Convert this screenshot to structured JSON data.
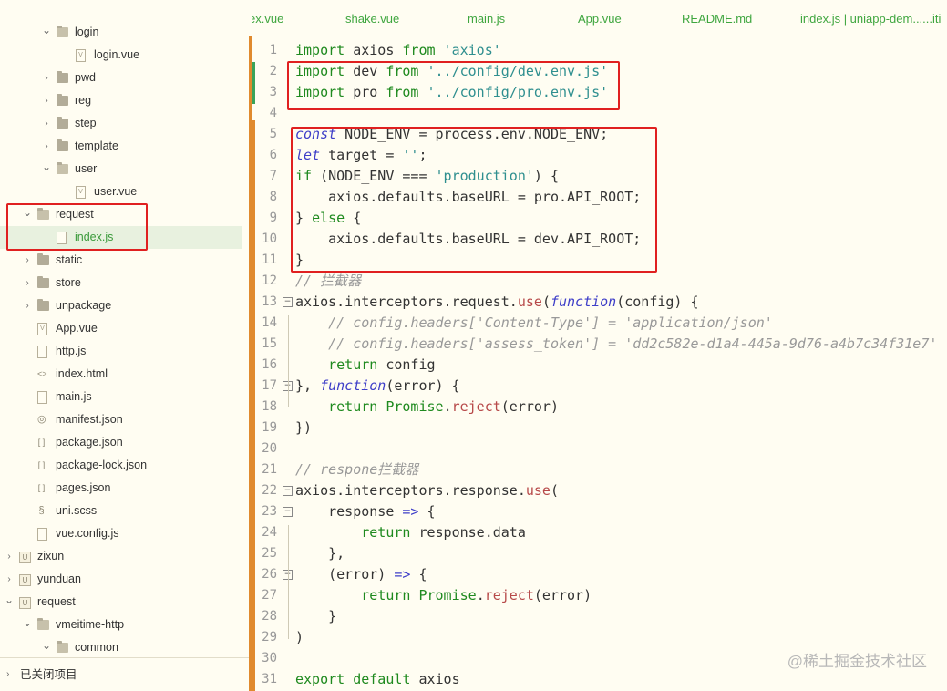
{
  "sidebar": {
    "items": [
      {
        "label": "login",
        "type": "folder",
        "expanded": true,
        "depth": 2
      },
      {
        "label": "login.vue",
        "type": "vue",
        "depth": 3
      },
      {
        "label": "pwd",
        "type": "folder",
        "expanded": false,
        "depth": 2
      },
      {
        "label": "reg",
        "type": "folder",
        "expanded": false,
        "depth": 2
      },
      {
        "label": "step",
        "type": "folder",
        "expanded": false,
        "depth": 2
      },
      {
        "label": "template",
        "type": "folder",
        "expanded": false,
        "depth": 2
      },
      {
        "label": "user",
        "type": "folder",
        "expanded": true,
        "depth": 2
      },
      {
        "label": "user.vue",
        "type": "vue",
        "depth": 3
      },
      {
        "label": "request",
        "type": "folder",
        "expanded": true,
        "depth": 1
      },
      {
        "label": "index.js",
        "type": "js",
        "depth": 2,
        "selected": true
      },
      {
        "label": "static",
        "type": "folder",
        "expanded": false,
        "depth": 1
      },
      {
        "label": "store",
        "type": "folder",
        "expanded": false,
        "depth": 1
      },
      {
        "label": "unpackage",
        "type": "folder",
        "expanded": false,
        "depth": 1
      },
      {
        "label": "App.vue",
        "type": "vue",
        "depth": 1
      },
      {
        "label": "http.js",
        "type": "js",
        "depth": 1
      },
      {
        "label": "index.html",
        "type": "html",
        "depth": 1
      },
      {
        "label": "main.js",
        "type": "js",
        "depth": 1
      },
      {
        "label": "manifest.json",
        "type": "manifest",
        "depth": 1
      },
      {
        "label": "package.json",
        "type": "json",
        "depth": 1
      },
      {
        "label": "package-lock.json",
        "type": "json",
        "depth": 1
      },
      {
        "label": "pages.json",
        "type": "json",
        "depth": 1
      },
      {
        "label": "uni.scss",
        "type": "scss",
        "depth": 1
      },
      {
        "label": "vue.config.js",
        "type": "js",
        "depth": 1
      },
      {
        "label": "zixun",
        "type": "project",
        "expanded": false,
        "depth": 0
      },
      {
        "label": "yunduan",
        "type": "project",
        "expanded": false,
        "depth": 0
      },
      {
        "label": "request",
        "type": "project",
        "expanded": true,
        "depth": 0
      },
      {
        "label": "vmeitime-http",
        "type": "folder",
        "expanded": true,
        "depth": 1
      },
      {
        "label": "common",
        "type": "folder",
        "expanded": true,
        "depth": 2
      }
    ],
    "footer_label": "已关闭项目"
  },
  "tabs": [
    {
      "label": "ex.vue"
    },
    {
      "label": "shake.vue"
    },
    {
      "label": "main.js"
    },
    {
      "label": "App.vue"
    },
    {
      "label": "README.md"
    },
    {
      "label": "index.js | uniapp-dem......iti"
    }
  ],
  "editor": {
    "line_numbers": [
      "1",
      "2",
      "3",
      "4",
      "5",
      "6",
      "7",
      "8",
      "9",
      "10",
      "11",
      "12",
      "13",
      "14",
      "15",
      "16",
      "17",
      "18",
      "19",
      "20",
      "21",
      "22",
      "23",
      "24",
      "25",
      "26",
      "27",
      "28",
      "29",
      "30",
      "31"
    ],
    "lines": [
      "import axios from 'axios'",
      "import dev from '../config/dev.env.js'",
      "import pro from '../config/pro.env.js'",
      "",
      "const NODE_ENV = process.env.NODE_ENV;",
      "let target = '';",
      "if (NODE_ENV === 'production') {",
      "    axios.defaults.baseURL = pro.API_ROOT;",
      "} else {",
      "    axios.defaults.baseURL = dev.API_ROOT;",
      "}",
      "// 拦截器",
      "axios.interceptors.request.use(function(config) {",
      "    // config.headers['Content-Type'] = 'application/json'",
      "    // config.headers['assess_token'] = 'dd2c582e-d1a4-445a-9d76-a4b7c34f31e7'",
      "    return config",
      "}, function(error) {",
      "    return Promise.reject(error)",
      "})",
      "",
      "// respone拦截器",
      "axios.interceptors.response.use(",
      "    response => {",
      "        return response.data",
      "    },",
      "    (error) => {",
      "        return Promise.reject(error)",
      "    }",
      ")",
      "",
      "export default axios"
    ]
  },
  "watermark": "@稀土掘金技术社区",
  "colors": {
    "background": "#fffdf2",
    "accent_green": "#3fa63f",
    "highlight_red": "#e02020",
    "splitter_orange": "#e08a2e"
  }
}
